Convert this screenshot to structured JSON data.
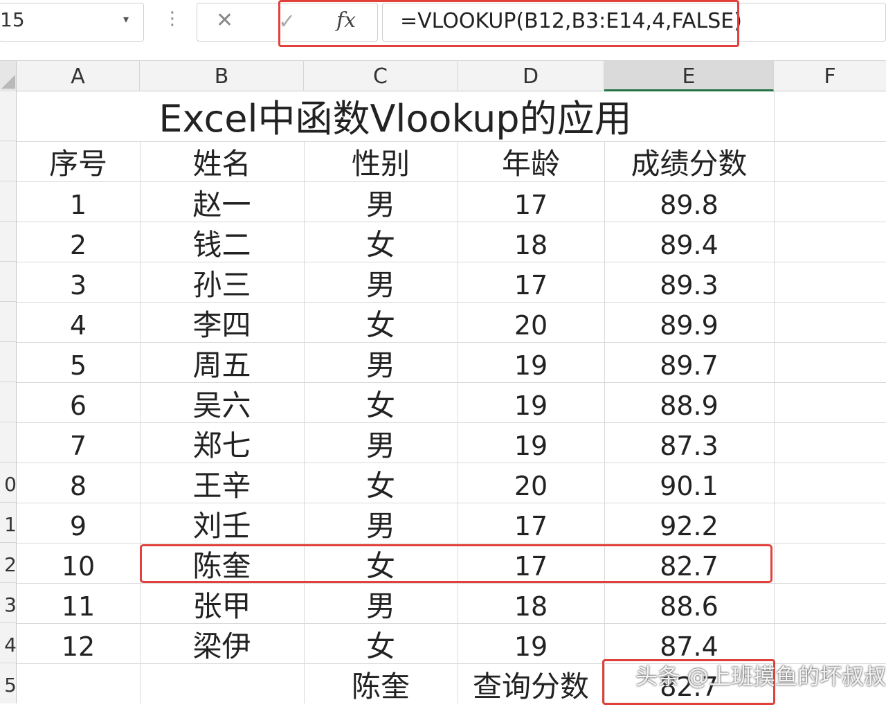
{
  "formula_bar": {
    "name_box": "15",
    "cancel_glyph": "✕",
    "enter_glyph": "✓",
    "fx_label": "fx",
    "formula": "=VLOOKUP(B12,B3:E14,4,FALSE)"
  },
  "columns": [
    "A",
    "B",
    "C",
    "D",
    "E",
    "F"
  ],
  "active_column": "E",
  "row_numbers": [
    "",
    "",
    "",
    "",
    "",
    "",
    "",
    "",
    "",
    "0",
    "1",
    "2",
    "3",
    "4",
    "5"
  ],
  "sheet": {
    "title": "Excel中函数Vlookup的应用",
    "headers": [
      "序号",
      "姓名",
      "性别",
      "年龄",
      "成绩分数"
    ],
    "rows": [
      [
        "1",
        "赵一",
        "男",
        "17",
        "89.8"
      ],
      [
        "2",
        "钱二",
        "女",
        "18",
        "89.4"
      ],
      [
        "3",
        "孙三",
        "男",
        "17",
        "89.3"
      ],
      [
        "4",
        "李四",
        "女",
        "20",
        "89.9"
      ],
      [
        "5",
        "周五",
        "男",
        "19",
        "89.7"
      ],
      [
        "6",
        "吴六",
        "女",
        "19",
        "88.9"
      ],
      [
        "7",
        "郑七",
        "男",
        "19",
        "87.3"
      ],
      [
        "8",
        "王辛",
        "女",
        "20",
        "90.1"
      ],
      [
        "9",
        "刘壬",
        "男",
        "17",
        "92.2"
      ],
      [
        "10",
        "陈奎",
        "女",
        "17",
        "82.7"
      ],
      [
        "11",
        "张甲",
        "男",
        "18",
        "88.6"
      ],
      [
        "12",
        "梁伊",
        "女",
        "19",
        "87.4"
      ]
    ],
    "lookup": {
      "name": "陈奎",
      "label": "查询分数",
      "result": "82.7"
    }
  },
  "watermark": "头条 @上班摸鱼的坏叔叔",
  "colors": {
    "highlight": "#e0413b",
    "active_col_underline": "#217346"
  }
}
